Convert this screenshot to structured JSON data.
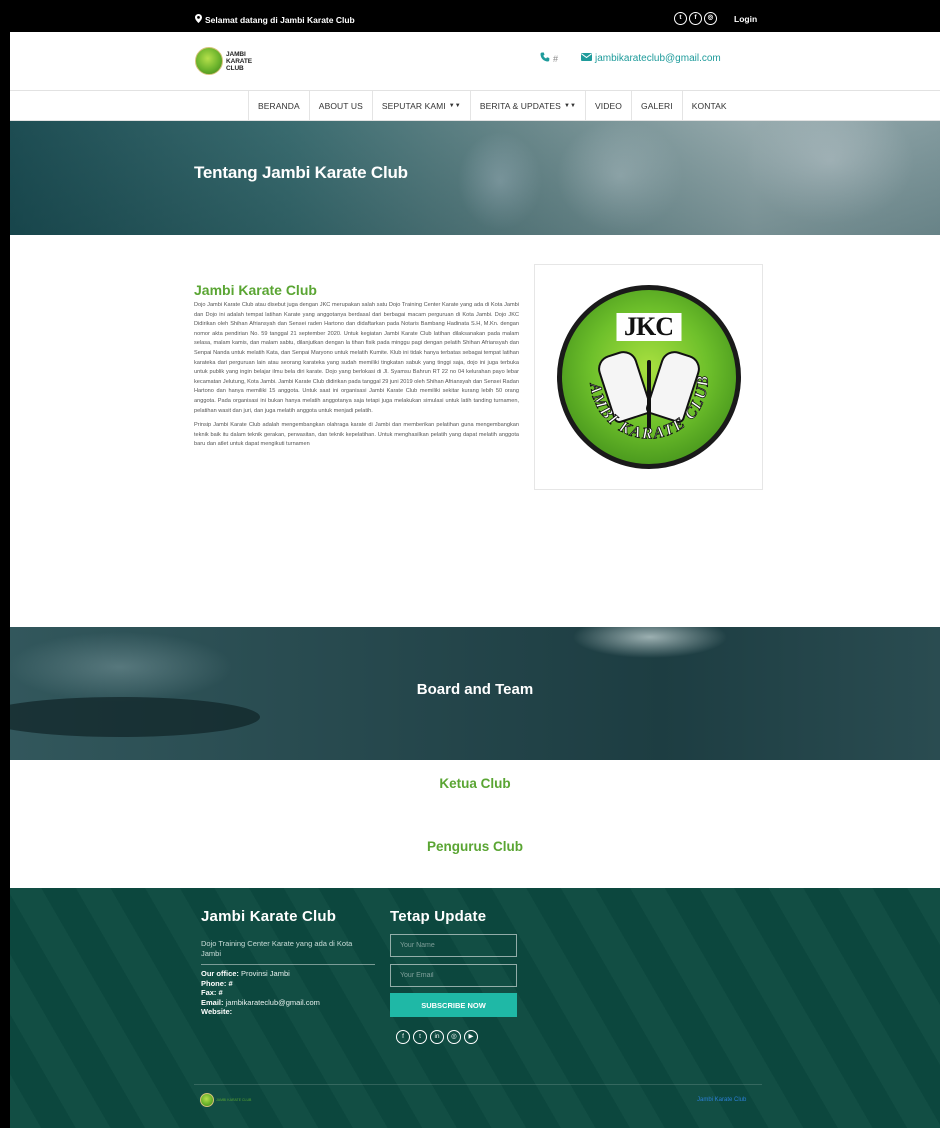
{
  "topbar": {
    "welcome": "Selamat datang di Jambi Karate Club",
    "login": "Login",
    "social_icons": [
      "twitter-icon",
      "facebook-icon",
      "instagram-icon"
    ]
  },
  "header": {
    "logo_text": "JAMBI KARATE CLUB",
    "phone": "#",
    "email": "jambikarateclub@gmail.com"
  },
  "nav": {
    "items": [
      {
        "label": "BERANDA",
        "dropdown": false
      },
      {
        "label": "ABOUT US",
        "dropdown": false
      },
      {
        "label": "SEPUTAR KAMI",
        "dropdown": true
      },
      {
        "label": "BERITA & UPDATES",
        "dropdown": true
      },
      {
        "label": "VIDEO",
        "dropdown": false
      },
      {
        "label": "GALERI",
        "dropdown": false
      },
      {
        "label": "KONTAK",
        "dropdown": false
      }
    ]
  },
  "hero": {
    "title": "Tentang Jambi Karate Club"
  },
  "about": {
    "heading": "Jambi Karate Club",
    "paragraph1": "Dojo Jambi Karate Club atau disebut juga dengan JKC merupakan salah satu Dojo Training Center Karate yang ada di Kota Jambi dan Dojo ini adalah tempat latihan Karate yang anggotanya berdasal dari berbagai macam perguruan di Kota Jambi. Dojo JKC Didirikan oleh Shihan Afriansyah dan Sensei raden Hartono dan didaftarkan pada Notaris Bambang Hadinata S.H, M.Kn. dengan nomor akta pendirian No. 59 tanggal 21 september 2020. Untuk kegiatan Jambi Karate Club latihan dilaksanakan pada malam selasa, malam kamis, dan malam sabtu, dilanjutkan dengan la tihan fisik pada minggu pagi dengan pelatih Shihan Afriansyah dan Senpai Nanda untuk melatih Kata, dan Senpai Maryono untuk melatih Kumite. Klub ini tidak hanya terbatas sebagai tempat latihan karateka dari perguruan lain atau seorang karateka yang sudah memiliki tingkatan sabuk yang tinggi saja, dojo ini juga terbuka untuk publik yang ingin belajar ilmu bela diri karate. Dojo yang berlokasi di Jl. Syamsu Bahrun RT 22 no 04 kelurahan payo lebar kecamatan Jelutung, Kota Jambi. Jambi Karate Club didirikan pada tanggal 29 juni 2019 oleh Shihan Afriansyah dan Sensei Radan Hartono dan hanya memiliki 15 anggota. Untuk saat ini organisasi Jambi Karate Club memiliki sekitar kurang lebih 50 orang anggota. Pada organisasi ini bukan hanya melatih anggotanya saja tetapi juga melakukan simulasi untuk latih tanding turnamen, pelatihan wasit dan juri, dan juga melatih anggota untuk menjadi pelatih.",
    "paragraph2": "Prinsip Jambi Karate Club adalah mengembangkan olahraga karate di Jambi dan memberikan pelatihan guna mengembangkan teknik baik itu dalam teknik gerakan, perwasitan, dan teknik kepelatihan. Untuk menghasilkan pelatih yang dapat melatih anggota baru dan atlet untuk dapat mengikuti turnamen",
    "emblem_top": "JKC",
    "emblem_ring": "JAMBI KARATE CLUB"
  },
  "board": {
    "title": "Board and Team",
    "ketua": "Ketua Club",
    "pengurus": "Pengurus Club"
  },
  "footer": {
    "title": "Jambi Karate Club",
    "description": "Dojo Training Center Karate yang ada di Kota Jambi",
    "office_label": "Our office:",
    "office_value": "Provinsi Jambi",
    "phone_label": "Phone:",
    "phone_value": "#",
    "fax_label": "Fax:",
    "fax_value": "#",
    "email_label": "Email:",
    "email_value": "jambikarateclub@gmail.com",
    "website_label": "Website:",
    "newsletter_title": "Tetap Update",
    "name_placeholder": "Your Name",
    "email_placeholder": "Your Email",
    "subscribe_label": "SUBSCRIBE NOW",
    "social_icons": [
      "facebook-icon",
      "twitter-icon",
      "linkedin-icon",
      "instagram-icon",
      "youtube-icon"
    ],
    "copyright": "Jambi Karate Club"
  },
  "colors": {
    "accent_green": "#5aa533",
    "teal": "#1e9b9b",
    "footer_bg": "#0c4a40",
    "subscribe_bg": "#1fb8a6"
  }
}
